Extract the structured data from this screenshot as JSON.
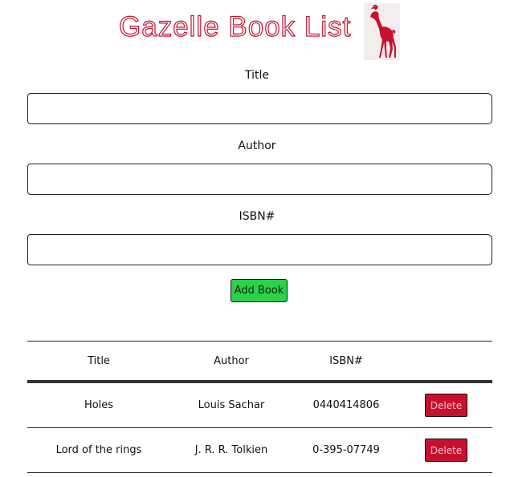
{
  "header": {
    "title": "Gazelle Book List",
    "logo_icon": "gazelle-icon",
    "title_color": "#c8102e"
  },
  "form": {
    "title_label": "Title",
    "title_value": "",
    "author_label": "Author",
    "author_value": "",
    "isbn_label": "ISBN#",
    "isbn_value": "",
    "add_button_label": "Add Book",
    "add_button_color": "#2bd14a"
  },
  "table": {
    "headers": {
      "title": "Title",
      "author": "Author",
      "isbn": "ISBN#"
    },
    "rows": [
      {
        "title": "Holes",
        "author": "Louis Sachar",
        "isbn": "0440414806",
        "delete_label": "Delete"
      },
      {
        "title": "Lord of the rings",
        "author": "J. R. R. Tolkien",
        "isbn": "0-395-07749",
        "delete_label": "Delete"
      }
    ],
    "delete_button_color": "#c8102e"
  }
}
